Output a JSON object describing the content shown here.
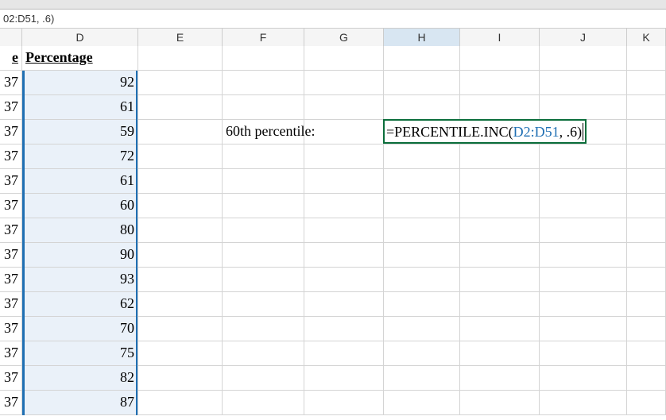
{
  "formula_bar": "02:D51, .6)",
  "columns": [
    {
      "letter": "",
      "w": "colC",
      "active": false
    },
    {
      "letter": "D",
      "w": "colD",
      "active": false
    },
    {
      "letter": "E",
      "w": "colE",
      "active": false
    },
    {
      "letter": "F",
      "w": "colF",
      "active": false
    },
    {
      "letter": "G",
      "w": "colG",
      "active": false
    },
    {
      "letter": "H",
      "w": "colH",
      "active": true
    },
    {
      "letter": "I",
      "w": "colI",
      "active": false
    },
    {
      "letter": "J",
      "w": "colJ",
      "active": false
    },
    {
      "letter": "K",
      "w": "colK",
      "active": false
    }
  ],
  "headerRow": {
    "cText": "e",
    "dText": "Percentage"
  },
  "dataRows": [
    {
      "c": "37",
      "d": "92"
    },
    {
      "c": "37",
      "d": "61"
    },
    {
      "c": "37",
      "d": "59"
    },
    {
      "c": "37",
      "d": "72"
    },
    {
      "c": "37",
      "d": "61"
    },
    {
      "c": "37",
      "d": "60"
    },
    {
      "c": "37",
      "d": "80"
    },
    {
      "c": "37",
      "d": "90"
    },
    {
      "c": "37",
      "d": "93"
    },
    {
      "c": "37",
      "d": "62"
    },
    {
      "c": "37",
      "d": "70"
    },
    {
      "c": "37",
      "d": "75"
    },
    {
      "c": "37",
      "d": "82"
    },
    {
      "c": "37",
      "d": "87"
    }
  ],
  "label": "60th percentile:",
  "formula": {
    "eq": "=",
    "fn": "PERCENTILE.INC(",
    "ref": "D2:D51",
    "tail": ", .6)"
  },
  "chart_data": {
    "type": "table",
    "title": "Percentage",
    "columns": [
      "Percentage"
    ],
    "values": [
      92,
      61,
      59,
      72,
      61,
      60,
      80,
      90,
      93,
      62,
      70,
      75,
      82,
      87
    ],
    "formula_cell": "H4",
    "formula_text": "=PERCENTILE.INC(D2:D51, .6)",
    "label_cell": "F4",
    "label_text": "60th percentile:"
  }
}
